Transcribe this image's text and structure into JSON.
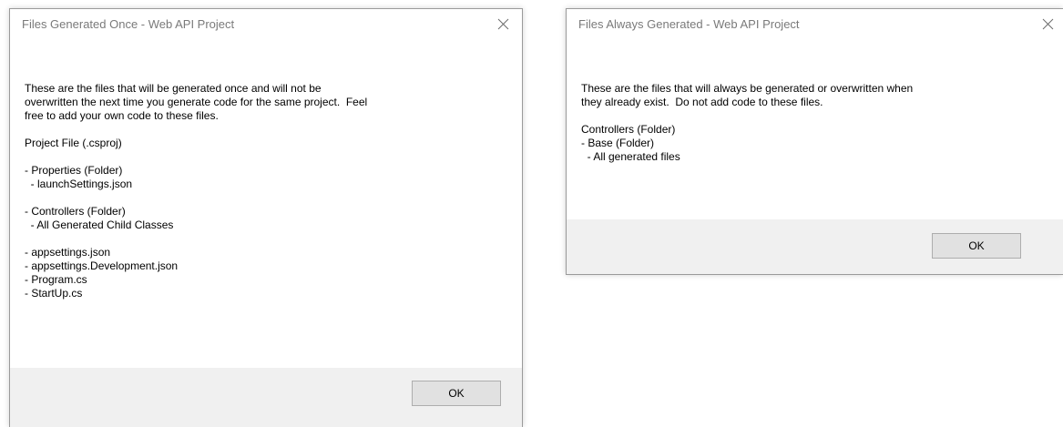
{
  "dialogs": {
    "once": {
      "title": "Files Generated Once - Web API Project",
      "message": "These are the files that will be generated once and will not be\noverwritten the next time you generate code for the same project.  Feel\nfree to add your own code to these files.\n\nProject File (.csproj)\n\n- Properties (Folder)\n  - launchSettings.json\n\n- Controllers (Folder)\n  - All Generated Child Classes\n\n- appsettings.json\n- appsettings.Development.json\n- Program.cs\n- StartUp.cs",
      "ok_label": "OK"
    },
    "always": {
      "title": "Files Always Generated - Web API Project",
      "message": "These are the files that will always be generated or overwritten when\nthey already exist.  Do not add code to these files.\n\nControllers (Folder)\n- Base (Folder)\n  - All generated files",
      "ok_label": "OK"
    }
  },
  "icons": {
    "close": "close-icon"
  },
  "colors": {
    "title_text": "#7a7a7a",
    "footer_bg": "#f0f0f0",
    "button_bg": "#e1e1e1",
    "button_border": "#adadad"
  }
}
